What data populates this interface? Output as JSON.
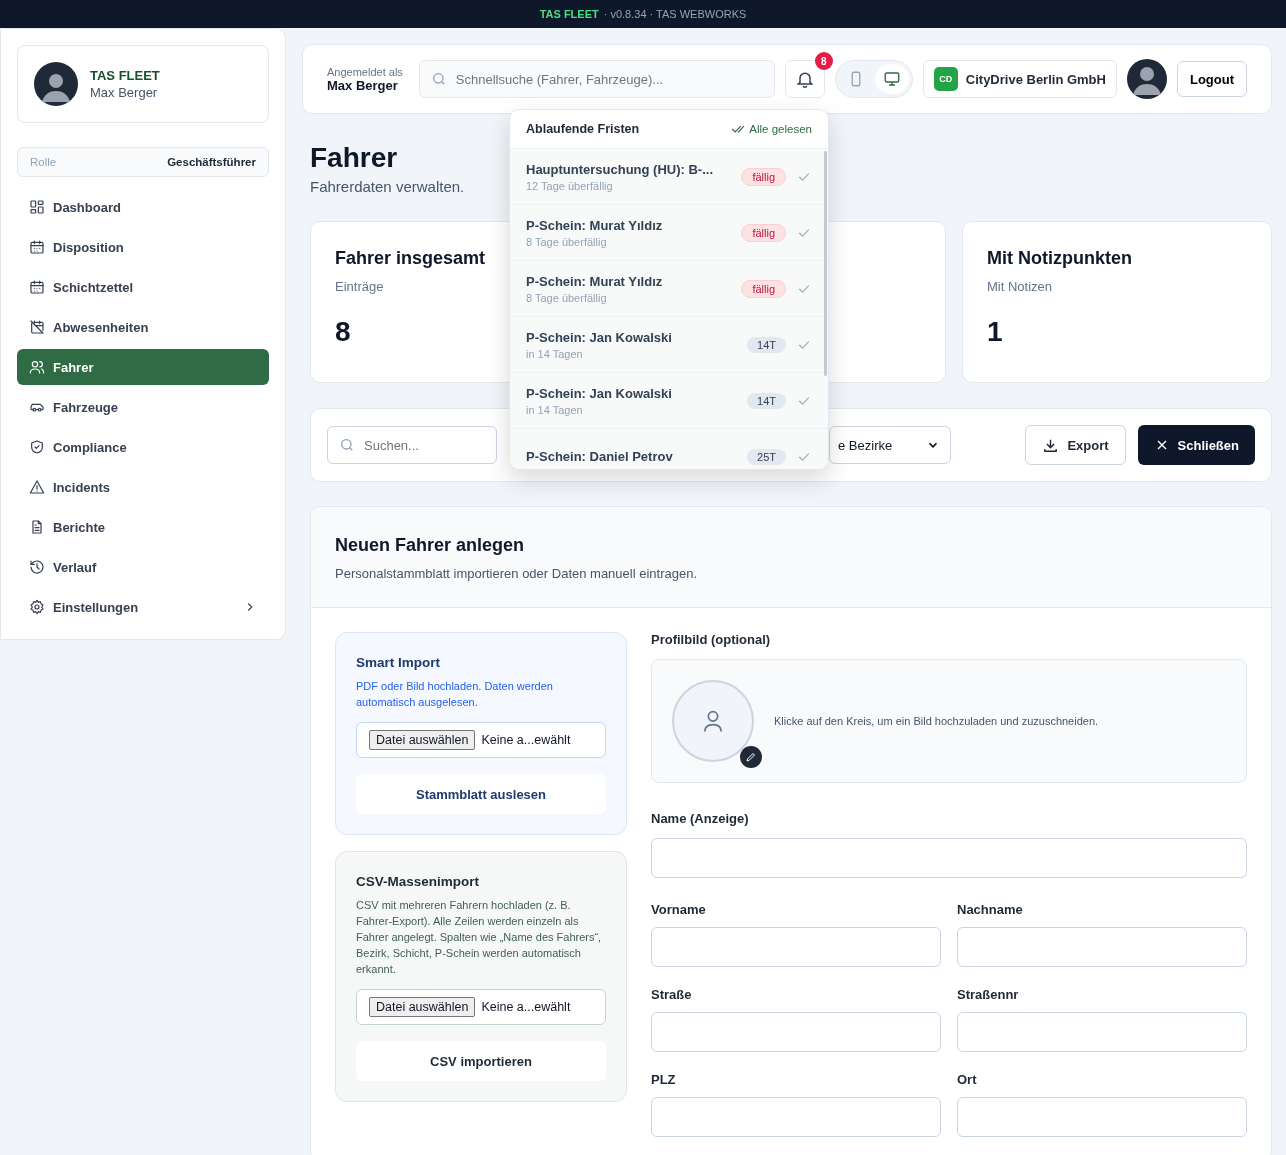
{
  "top_bar": {
    "brand": "TAS FLEET",
    "rest": "· v0.8.34 · TAS WEBWORKS"
  },
  "sidebar": {
    "brand": "TAS FLEET",
    "user": "Max Berger",
    "role_label": "Rolle",
    "role_value": "Geschäftsführer",
    "items": [
      {
        "label": "Dashboard",
        "selected": false,
        "has_submenu": false
      },
      {
        "label": "Disposition",
        "selected": false,
        "has_submenu": false
      },
      {
        "label": "Schichtzettel",
        "selected": false,
        "has_submenu": false
      },
      {
        "label": "Abwesenheiten",
        "selected": false,
        "has_submenu": false
      },
      {
        "label": "Fahrer",
        "selected": true,
        "has_submenu": false
      },
      {
        "label": "Fahrzeuge",
        "selected": false,
        "has_submenu": false
      },
      {
        "label": "Compliance",
        "selected": false,
        "has_submenu": false
      },
      {
        "label": "Incidents",
        "selected": false,
        "has_submenu": false
      },
      {
        "label": "Berichte",
        "selected": false,
        "has_submenu": false
      },
      {
        "label": "Verlauf",
        "selected": false,
        "has_submenu": false
      },
      {
        "label": "Einstellungen",
        "selected": false,
        "has_submenu": true
      }
    ]
  },
  "header": {
    "logged_in_label": "Angemeldet als",
    "logged_in_user": "Max Berger",
    "search_placeholder": "Schnellsuche (Fahrer, Fahrzeuge)...",
    "notification_count": "8",
    "view_modes": [
      {
        "selected": false
      },
      {
        "selected": true
      }
    ],
    "company_badge": "CD",
    "company": "CityDrive Berlin GmbH",
    "logout": "Logout"
  },
  "notifications": {
    "title": "Ablaufende Fristen",
    "mark_all": "Alle gelesen",
    "items": [
      {
        "title": "Hauptuntersuchung (HU): B-...",
        "sub": "12 Tage überfällig",
        "badge": "fällig",
        "kind": "overdue"
      },
      {
        "title": "P-Schein: Murat Yıldız",
        "sub": "8 Tage überfällig",
        "badge": "fällig",
        "kind": "overdue"
      },
      {
        "title": "P-Schein: Murat Yıldız",
        "sub": "8 Tage überfällig",
        "badge": "fällig",
        "kind": "overdue"
      },
      {
        "title": "P-Schein: Jan Kowalski",
        "sub": "in 14 Tagen",
        "badge": "14T",
        "kind": "upcoming"
      },
      {
        "title": "P-Schein: Jan Kowalski",
        "sub": "in 14 Tagen",
        "badge": "14T",
        "kind": "upcoming"
      },
      {
        "title": "P-Schein: Daniel Petrov",
        "badge": "25T",
        "kind": "upcoming"
      }
    ]
  },
  "page": {
    "title": "Fahrer",
    "subtitle": "Fahrerdaten verwalten."
  },
  "stats": [
    {
      "title": "Fahrer insgesamt",
      "label": "Einträge",
      "value": "8"
    },
    {
      "title": "Mit Notizpunkten",
      "label": "Mit Notizen",
      "value": "1"
    }
  ],
  "filters": {
    "search_placeholder": "Suchen...",
    "district_select": "e Bezirke",
    "export": "Export",
    "close": "Schließen"
  },
  "form": {
    "title": "Neuen Fahrer anlegen",
    "subtitle": "Personalstammblatt importieren oder Daten manuell eintragen.",
    "imports": [
      {
        "kind": "smart",
        "title": "Smart Import",
        "text": "PDF oder Bild hochladen. Daten werden automatisch ausgelesen.",
        "file_button": "Datei auswählen",
        "file_status": "Keine a...ewählt",
        "action": "Stammblatt auslesen"
      },
      {
        "kind": "csv",
        "title": "CSV-Massenimport",
        "text": "CSV mit mehreren Fahrern hochladen (z. B. Fahrer-Export). Alle Zeilen werden einzeln als Fahrer angelegt. Spalten wie „Name des Fahrers“, Bezirk, Schicht, P-Schein werden automatisch erkannt.",
        "file_button": "Datei auswählen",
        "file_status": "Keine a...ewählt",
        "action": "CSV importieren"
      }
    ],
    "photo_label": "Profilbild (optional)",
    "photo_hint": "Klicke auf den Kreis, um ein Bild hochzuladen und zuzuschneiden.",
    "name_label": "Name (Anzeige)",
    "fields": [
      {
        "label": "Vorname"
      },
      {
        "label": "Nachname"
      },
      {
        "label": "Straße"
      },
      {
        "label": "Straßennr"
      },
      {
        "label": "PLZ"
      },
      {
        "label": "Ort"
      }
    ]
  }
}
